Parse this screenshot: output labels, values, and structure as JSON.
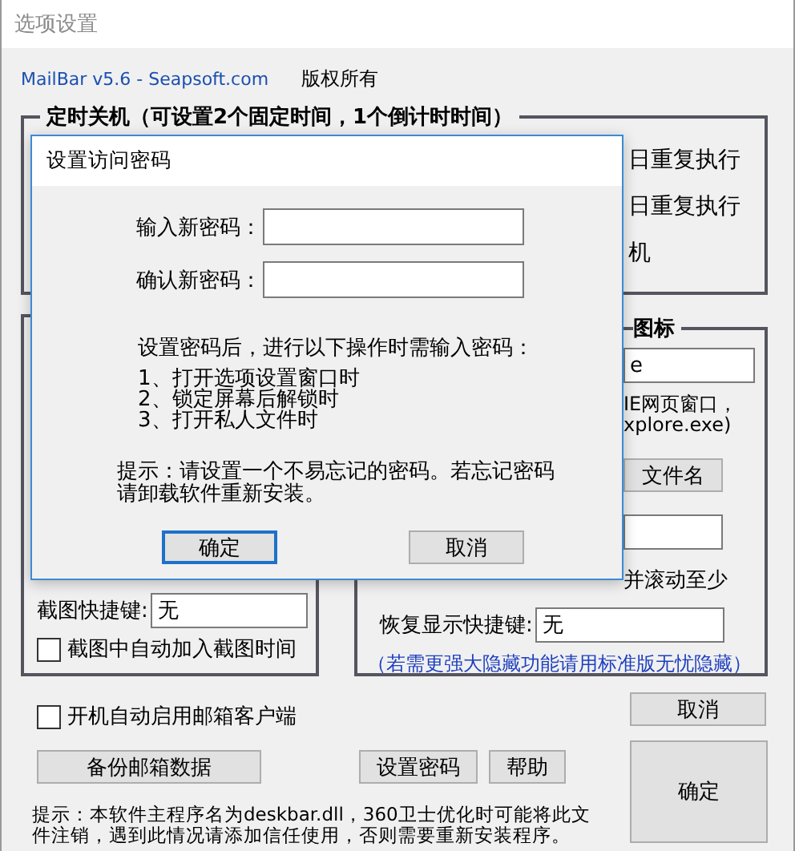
{
  "window": {
    "title": "选项设置"
  },
  "header": {
    "product": "MailBar v5.6 - Seapsoft.com",
    "copyright": "版权所有"
  },
  "shutdown_group": {
    "title": "定时关机（可设置2个固定时间，1个倒计时时间）",
    "texts": [
      "日重复执行",
      "日重复执行",
      "机"
    ]
  },
  "capture_group": {
    "hotkey": {
      "label": "截图快捷键:",
      "value": "无"
    },
    "add_time": {
      "label": "截图中自动加入截图时间",
      "checked": false
    }
  },
  "hide_group": {
    "title": "图标",
    "path_field": {
      "value": "e"
    },
    "note_lines": [
      "IE网页窗口，",
      "xplore.exe)"
    ],
    "filename_button": "文件名",
    "scroll_text": "并滚动至少",
    "restore_hotkey": {
      "label": "恢复显示快捷键:",
      "value": "无"
    },
    "upgrade_note": "（若需更强大隐藏功能请用标准版无忧隐藏）"
  },
  "autostart": {
    "label": "开机自动启用邮箱客户端",
    "checked": false
  },
  "buttons": {
    "backup": "备份邮箱数据",
    "set_password": "设置密码",
    "help": "帮助",
    "cancel": "取消",
    "ok": "确定"
  },
  "hint_lines": [
    "提示：本软件主程序名为deskbar.dll，360卫士优化时可能将此文",
    "件注销，遇到此情况请添加信任使用，否则需要重新安装程序。"
  ],
  "dialog": {
    "title": "设置访问密码",
    "fields": [
      {
        "label": "输入新密码："
      },
      {
        "label": "确认新密码："
      }
    ],
    "intro": "设置密码后，进行以下操作时需输入密码：",
    "steps": [
      "1、打开选项设置窗口时",
      "2、锁定屏幕后解锁时",
      "3、打开私人文件时"
    ],
    "hint_lines": [
      "提示：请设置一个不易忘记的密码。若忘记密码",
      "请卸载软件重新安装。"
    ],
    "buttons": [
      {
        "label": "确定",
        "focused": true
      },
      {
        "label": "取消",
        "focused": false
      }
    ]
  }
}
